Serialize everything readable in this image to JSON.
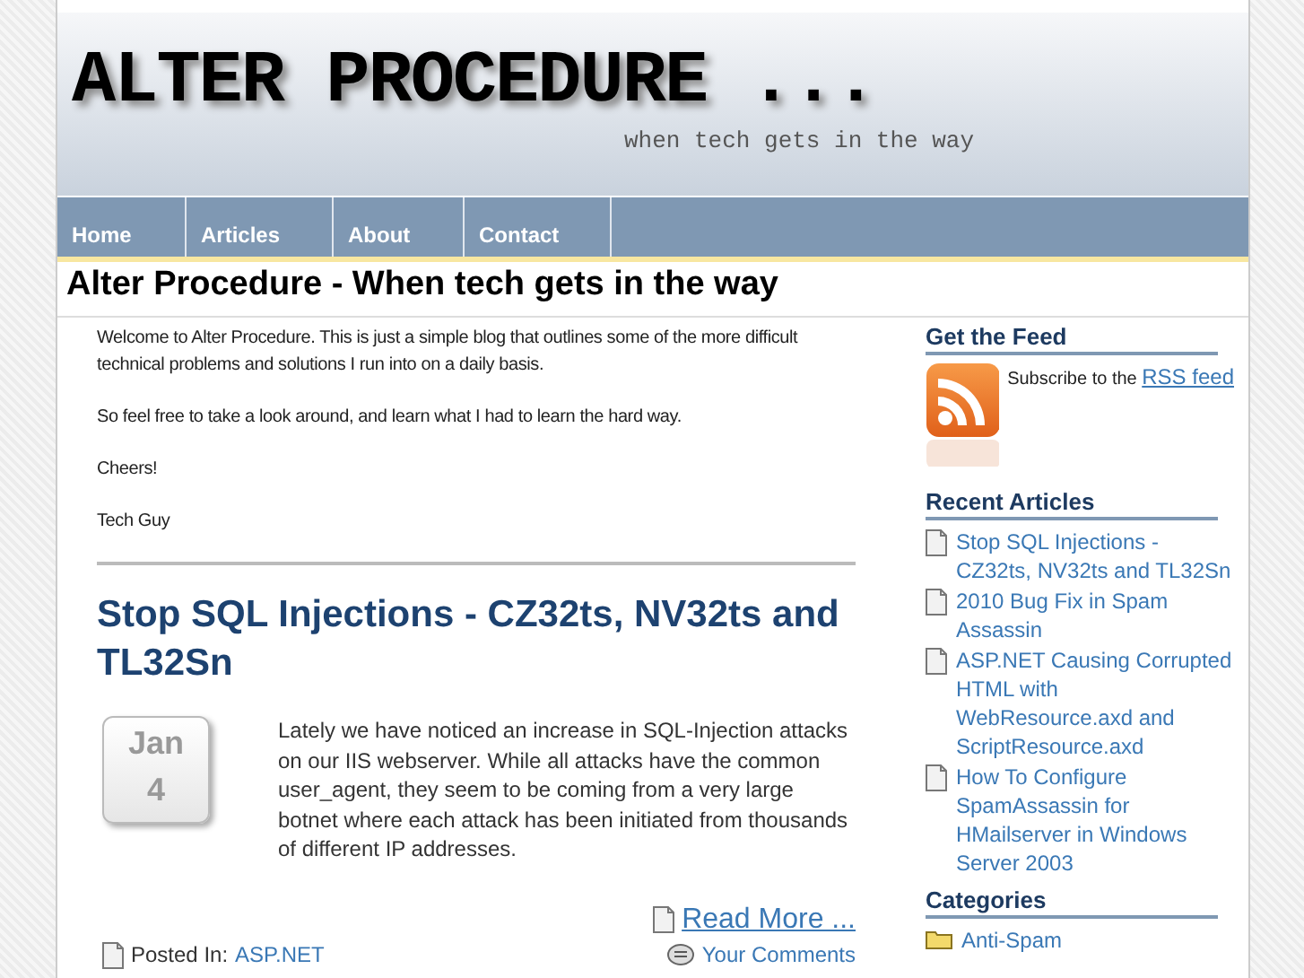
{
  "header": {
    "title": "ALTER PROCEDURE ...",
    "tagline": "when tech gets in the way"
  },
  "nav": [
    {
      "label": "Home"
    },
    {
      "label": "Articles"
    },
    {
      "label": "About"
    },
    {
      "label": "Contact"
    }
  ],
  "page_title": "Alter Procedure - When tech gets in the way",
  "intro": [
    "Welcome to Alter Procedure. This is just a simple blog that outlines some of the more difficult technical problems and solutions I run into on a daily basis.",
    "So feel free to take a look around, and learn what I had to learn the hard way.",
    "Cheers!",
    "Tech Guy"
  ],
  "post": {
    "title": "Stop SQL Injections - CZ32ts, NV32ts and TL32Sn",
    "month": "Jan",
    "day": "4",
    "excerpt": "Lately we have noticed an increase in SQL-Injection attacks on our IIS webserver. While all attacks have the common user_agent, they seem to be coming from a very large botnet where each attack has been initiated from thousands of different IP addresses.",
    "read_more": "Read More ...",
    "posted_in_label": "Posted In:",
    "category": "ASP.NET",
    "comments": "Your Comments"
  },
  "sidebar": {
    "feed": {
      "heading": "Get the Feed",
      "text": "Subscribe to the",
      "link": "RSS feed"
    },
    "recent": {
      "heading": "Recent Articles",
      "items": [
        "Stop SQL Injections - CZ32ts, NV32ts and TL32Sn",
        "2010 Bug Fix in Spam Assassin",
        "ASP.NET Causing Corrupted HTML with WebResource.axd and ScriptResource.axd",
        "How To Configure SpamAssassin for HMailserver in Windows Server 2003"
      ]
    },
    "categories": {
      "heading": "Categories",
      "items": [
        "Anti-Spam"
      ]
    }
  }
}
